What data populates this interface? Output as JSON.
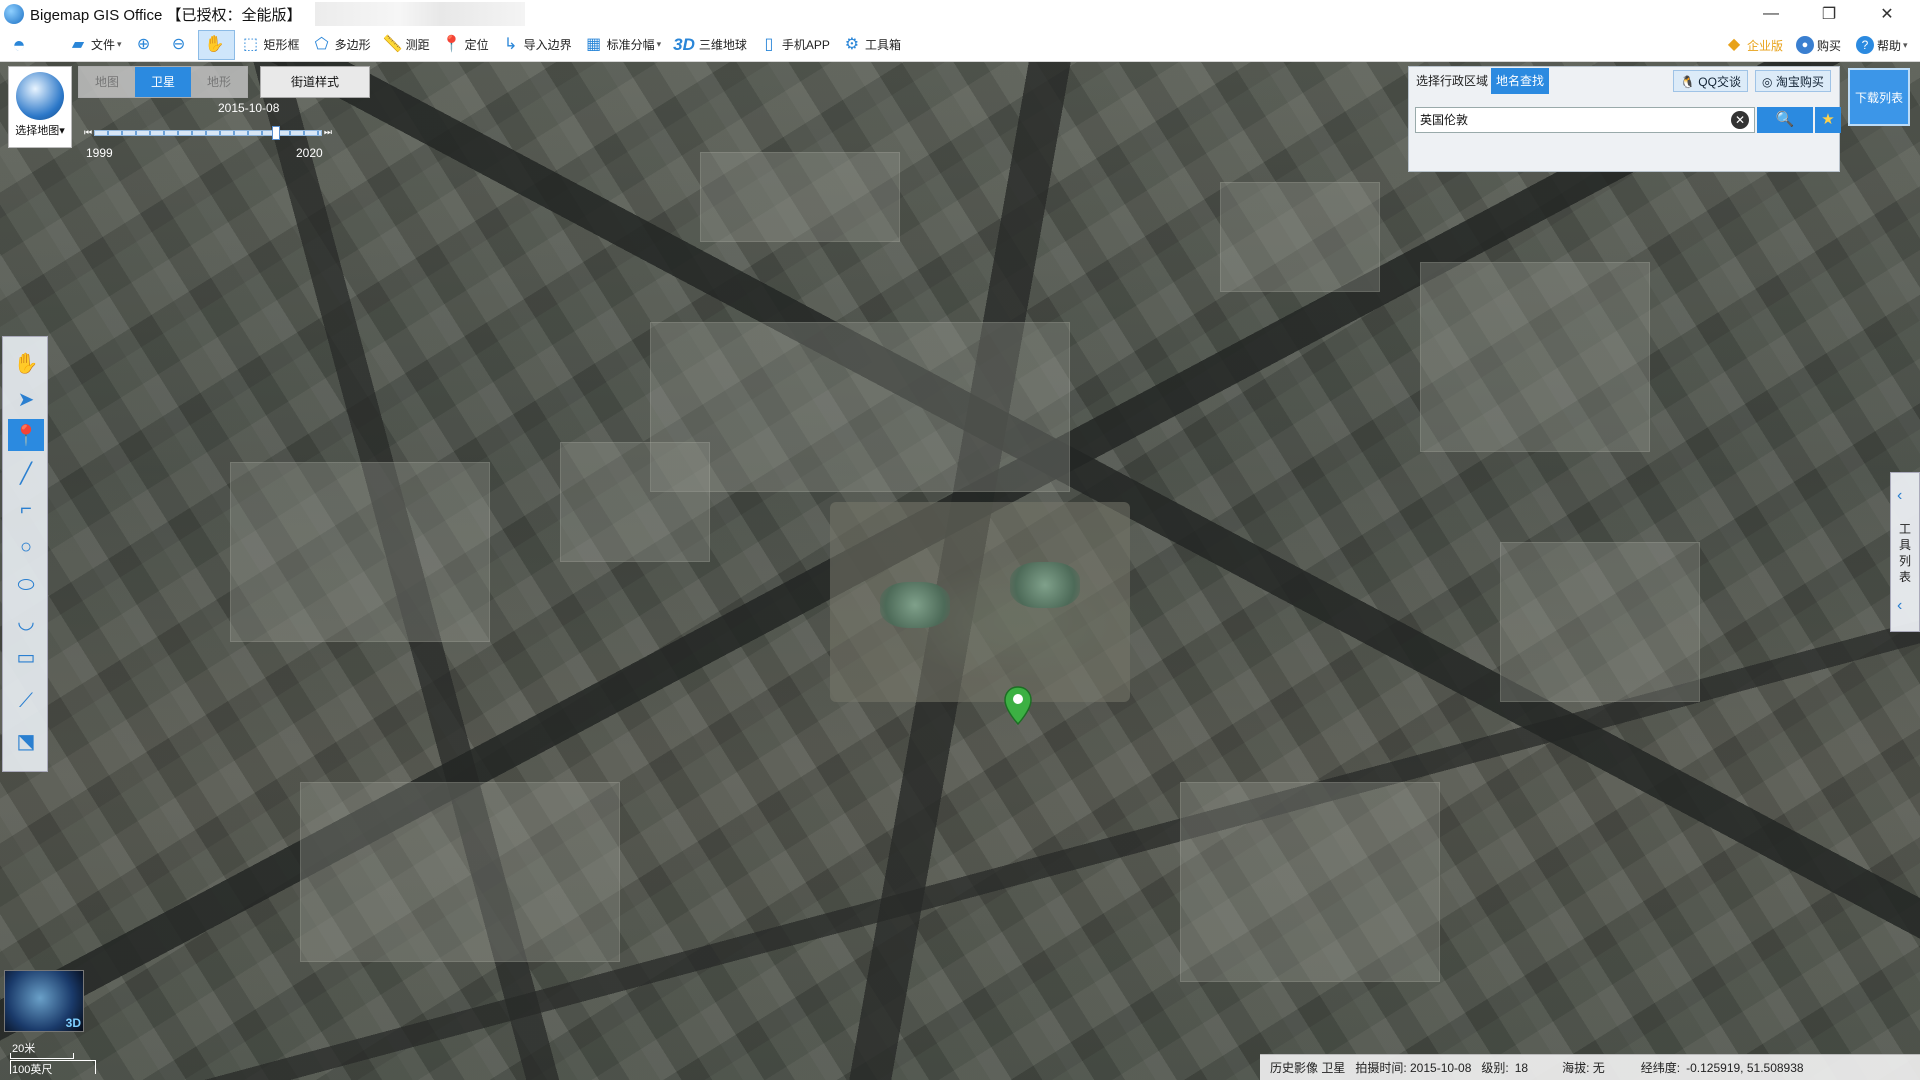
{
  "window": {
    "title": "Bigemap GIS Office 【已授权：全能版】",
    "controls": [
      "—",
      "❐",
      "✕"
    ]
  },
  "toolbar": {
    "items": [
      {
        "icon": "folder-icon",
        "label": "文件",
        "caret": "▾"
      },
      {
        "icon": "zoom-in-icon",
        "label": ""
      },
      {
        "icon": "zoom-out-icon",
        "label": ""
      },
      {
        "icon": "hand-pan-icon",
        "label": ""
      },
      {
        "icon": "rectangle-select-icon",
        "label": "矩形框"
      },
      {
        "icon": "polygon-icon",
        "label": "多边形"
      },
      {
        "icon": "ruler-icon",
        "label": "测距"
      },
      {
        "icon": "location-pin-icon",
        "label": "定位"
      },
      {
        "icon": "import-boundary-icon",
        "label": "导入边界"
      },
      {
        "icon": "grid-icon",
        "label": "标准分幅",
        "caret": "▾"
      },
      {
        "icon": "3d-icon",
        "label": "三维地球"
      },
      {
        "icon": "mobile-icon",
        "label": "手机APP"
      },
      {
        "icon": "gear-icon",
        "label": "工具箱"
      }
    ],
    "right": {
      "enterprise": "企业版",
      "buy": "购买",
      "help": "帮助"
    }
  },
  "map_type": {
    "selector_label": "选择地图",
    "tabs": [
      "地图",
      "卫星",
      "地形"
    ],
    "active_tab": "卫星",
    "street_style": "街道样式",
    "timeline": {
      "current_date": "2015-10-08",
      "start_year": "1999",
      "end_year": "2020",
      "position_fraction": 0.8
    }
  },
  "search_panel": {
    "tabs": [
      "选择行政区域",
      "地名查找"
    ],
    "active_tab": "地名查找",
    "qq_button": "QQ交谈",
    "taobao_button": "淘宝购买",
    "search_value": "英国伦敦",
    "download_list": "下载列表"
  },
  "left_tools": [
    "hand-pan-icon",
    "pointer-arrow-icon",
    "marker-pin-icon",
    "line-icon",
    "polyline-icon",
    "circle-icon",
    "ellipse-icon",
    "curve-icon",
    "rectangle-icon",
    "measure-icon",
    "polygon-edit-icon"
  ],
  "right_handle": {
    "text": "工具列表"
  },
  "globe_thumb": {
    "label": "3D"
  },
  "scale": {
    "metric": "20米",
    "imperial": "100英尺"
  },
  "status": {
    "imagery": "历史影像 卫星",
    "capture_label": "拍摄时间: 2015-10-08",
    "level_label": "级别:",
    "level": "18",
    "altitude_label": "海拔: 无",
    "coords_label": "经纬度:",
    "coords": "-0.125919, 51.508938"
  },
  "colors": {
    "accent": "#2b8ae0",
    "pin": "#3cb043"
  }
}
